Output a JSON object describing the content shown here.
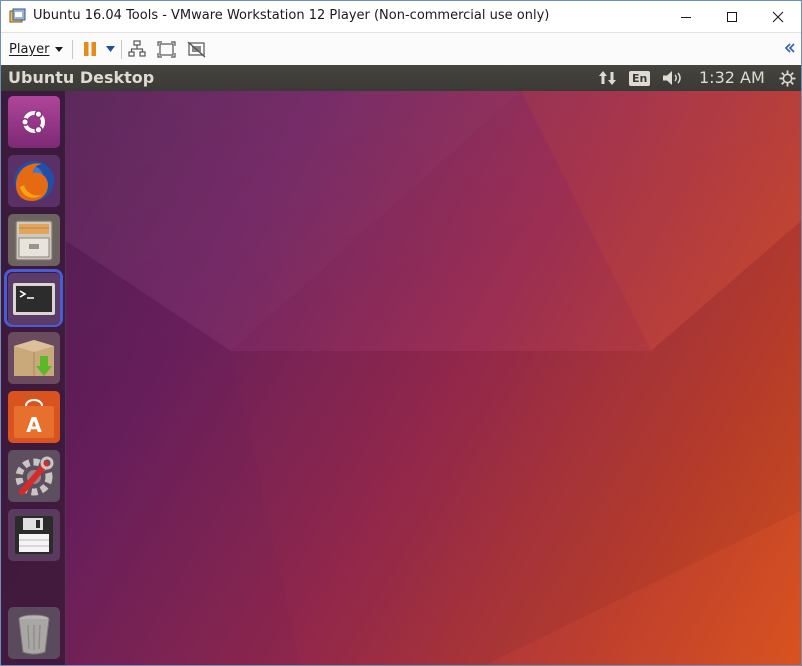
{
  "window": {
    "title": "Ubuntu 16.04 Tools - VMware Workstation 12 Player (Non-commercial use only)"
  },
  "toolbar": {
    "player_label": "Player"
  },
  "topbar": {
    "title": "Ubuntu Desktop",
    "keyboard_layout": "En",
    "clock": "1:32 AM"
  },
  "launcher": {
    "items": [
      {
        "name": "ubuntu-dash"
      },
      {
        "name": "firefox"
      },
      {
        "name": "files"
      },
      {
        "name": "terminal",
        "active": true
      },
      {
        "name": "archive-manager"
      },
      {
        "name": "ubuntu-software"
      },
      {
        "name": "system-settings"
      },
      {
        "name": "save-drive"
      },
      {
        "name": "trash"
      }
    ]
  },
  "colors": {
    "active_outline": "#4a5bd8",
    "panel_text": "#dfdbd2",
    "wallpaper_left": "#4b1a4f",
    "wallpaper_right": "#d9531f"
  }
}
